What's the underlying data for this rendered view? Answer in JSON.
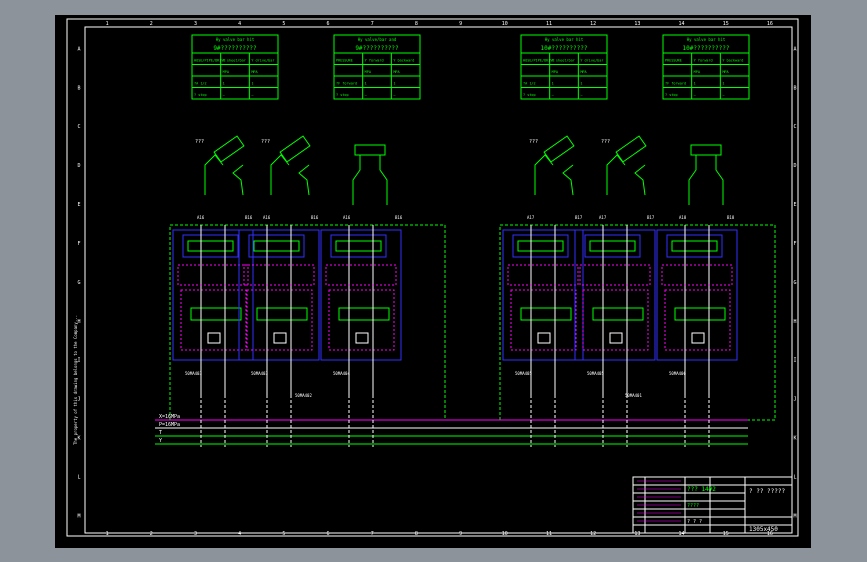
{
  "sheet": {
    "columns": [
      "1",
      "2",
      "3",
      "4",
      "5",
      "6",
      "7",
      "8",
      "9",
      "10",
      "11",
      "12",
      "13",
      "14",
      "15",
      "16"
    ],
    "rows": [
      "A",
      "B",
      "C",
      "D",
      "E",
      "F",
      "G",
      "H",
      "I",
      "J",
      "K",
      "L",
      "M"
    ],
    "side_note": "The property of this drawing belongs to the Company..."
  },
  "tables": [
    {
      "title": "Hy valve bar hit",
      "subtitle": "9#??????????",
      "rows": [
        [
          "HOSE/PIPE/DRIVE",
          "Y sheet/bar",
          "Y drive/bar"
        ],
        [
          "",
          "MPA",
          "MPA"
        ],
        [
          "?A 1/2",
          "1",
          "1"
        ],
        [
          "? stop",
          "—",
          "—"
        ]
      ]
    },
    {
      "title": "Hy valve/bar and",
      "subtitle": "9#??????????",
      "rows": [
        [
          "PRESSURE",
          "Y forward",
          "Y backward"
        ],
        [
          "",
          "MPA",
          "MPA"
        ],
        [
          "?F forward",
          "1",
          "1"
        ],
        [
          "? stop",
          "—",
          "—"
        ]
      ]
    },
    {
      "title": "Hy valve bar hit",
      "subtitle": "10#??????????",
      "rows": [
        [
          "HOSE/PIPE/DRIVE",
          "Y sheet/bar",
          "Y drive/bar"
        ],
        [
          "",
          "MPA",
          "MPA"
        ],
        [
          "?A 1/2",
          "1",
          "1"
        ],
        [
          "? stop",
          "—",
          "—"
        ]
      ]
    },
    {
      "title": "Hy valve bar hit",
      "subtitle": "10#??????????",
      "rows": [
        [
          "PRESSURE",
          "Y forward",
          "Y backward"
        ],
        [
          "",
          "MPA",
          "MPA"
        ],
        [
          "?F forward",
          "1",
          "1"
        ],
        [
          "? stop",
          "—",
          "—"
        ]
      ]
    }
  ],
  "left_group": {
    "cylinder_labels": [
      "???",
      "???"
    ],
    "port_labels": [
      "A16",
      "B16",
      "A16",
      "B16",
      "A16",
      "B16"
    ],
    "module_labels": [
      "50MA403",
      "50MA403",
      "50MA404"
    ],
    "block_label": "50MA402"
  },
  "right_group": {
    "cylinder_labels": [
      "???",
      "???"
    ],
    "port_labels": [
      "A17",
      "B17",
      "A17",
      "B17",
      "A18",
      "B18"
    ],
    "module_labels": [
      "50MA405",
      "50MA405",
      "50MA406"
    ],
    "block_label": "50MA401"
  },
  "supply_lines": [
    "X=16MPa",
    "P=16MPa",
    "T",
    "Y"
  ],
  "title_block": {
    "project": "??? 14#2",
    "company": "? ?? ?????",
    "drawing_name": "????",
    "drawing_no": "1305x450",
    "sheet_info": "? ? ?"
  },
  "colors": {
    "background": "#000000",
    "frame": "#ffffff",
    "hydraulic": "#00ff00",
    "pilot": "#ff00ff",
    "module": "#3030ff",
    "text": "#ffffff",
    "label": "#ffff00"
  }
}
